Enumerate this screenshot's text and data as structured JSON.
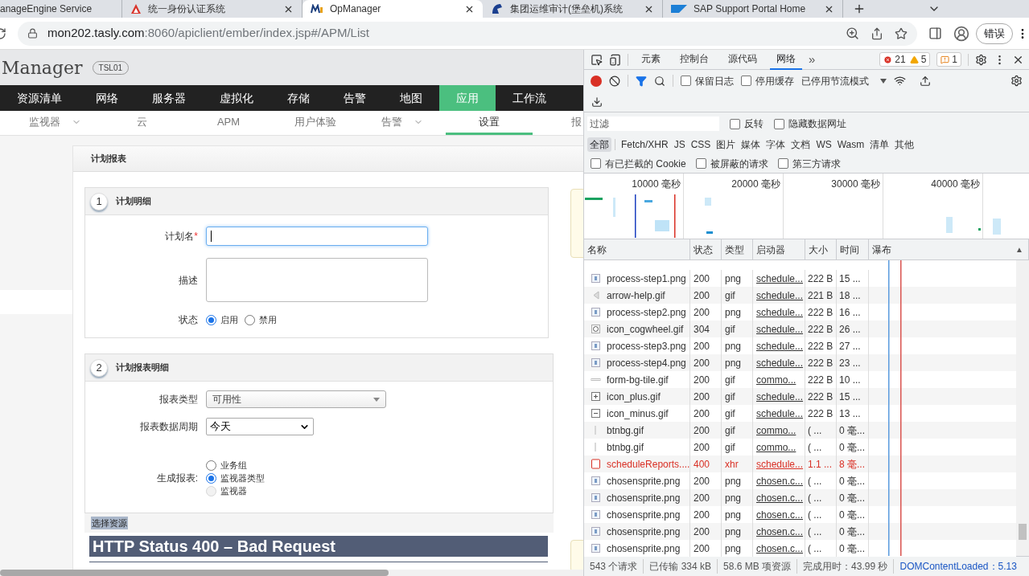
{
  "browser": {
    "tabs": [
      {
        "title": "anageEngine Service",
        "selected": false,
        "closable": false
      },
      {
        "title": "统一身份认证系统",
        "selected": false,
        "closable": true
      },
      {
        "title": "OpManager",
        "selected": true,
        "closable": true
      },
      {
        "title": "集团运维审计(堡垒机)系统",
        "selected": false,
        "closable": true
      },
      {
        "title": "SAP Support Portal Home",
        "selected": false,
        "closable": true
      }
    ],
    "url_host": "mon202.tasly.com",
    "url_path": ":8060/apiclient/ember/index.jsp#/APM/List",
    "profile_button": "错误"
  },
  "app": {
    "title": "Manager",
    "badge": "TSL01",
    "nav": [
      {
        "label": "资源清单",
        "selected": false
      },
      {
        "label": "网络",
        "selected": false
      },
      {
        "label": "服务器",
        "selected": false
      },
      {
        "label": "虚拟化",
        "selected": false
      },
      {
        "label": "存储",
        "selected": false
      },
      {
        "label": "告警",
        "selected": false
      },
      {
        "label": "地图",
        "selected": false
      },
      {
        "label": "应用",
        "selected": true
      },
      {
        "label": "工作流",
        "selected": false
      }
    ],
    "subnav": [
      {
        "label": "监视器",
        "selected": false,
        "dropdown": true
      },
      {
        "label": "云",
        "selected": false,
        "dropdown": false
      },
      {
        "label": "APM",
        "selected": false,
        "dropdown": false
      },
      {
        "label": "用户体验",
        "selected": false,
        "dropdown": false
      },
      {
        "label": "告警",
        "selected": false,
        "dropdown": true
      },
      {
        "label": "设置",
        "selected": true,
        "dropdown": false
      },
      {
        "label": "报",
        "selected": false,
        "dropdown": false
      }
    ],
    "card_title": "计划报表",
    "sections": [
      {
        "number": "1",
        "title": "计划明细",
        "fields": [
          {
            "kind": "text",
            "label": "计划名",
            "required_mark": "*",
            "focused": true
          },
          {
            "kind": "textarea",
            "label": "描述"
          },
          {
            "kind": "radio_row",
            "label": "状态",
            "options": [
              {
                "label": "启用",
                "selected": true,
                "disabled": false
              },
              {
                "label": "禁用",
                "selected": false,
                "disabled": false
              }
            ]
          }
        ]
      },
      {
        "number": "2",
        "title": "计划报表明细",
        "fields": [
          {
            "kind": "chosen_select",
            "label": "报表类型",
            "value": "可用性"
          },
          {
            "kind": "native_select",
            "label": "报表数据周期",
            "value": "今天"
          },
          {
            "kind": "radio_stack",
            "label": "生成报表:",
            "options": [
              {
                "label": "业务组",
                "selected": false,
                "disabled": false
              },
              {
                "label": "监视器类型",
                "selected": true,
                "disabled": false
              },
              {
                "label": "监视器",
                "selected": false,
                "disabled": true
              }
            ]
          }
        ]
      }
    ],
    "selected_text": "选择资源",
    "error_heading": "HTTP Status 400 – Bad Request"
  },
  "devtools": {
    "tabs": [
      {
        "label": "元素",
        "selected": false
      },
      {
        "label": "控制台",
        "selected": false
      },
      {
        "label": "源代码",
        "selected": false
      },
      {
        "label": "网络",
        "selected": true
      }
    ],
    "more_tabs": "»",
    "errors": "21",
    "warnings": "5",
    "issues": "1",
    "recording": true,
    "toolbar_checkboxes": [
      {
        "label": "保留日志",
        "checked": false
      },
      {
        "label": "停用缓存",
        "checked": false
      }
    ],
    "throttle": "已停用节流模式",
    "filter_placeholder": "过滤",
    "filter_checkboxes": [
      {
        "label": "反转",
        "checked": false
      },
      {
        "label": "隐藏数据网址",
        "checked": false
      }
    ],
    "type_filters": [
      {
        "label": "全部",
        "selected": true
      },
      {
        "label": "Fetch/XHR",
        "selected": false
      },
      {
        "label": "JS",
        "selected": false
      },
      {
        "label": "CSS",
        "selected": false
      },
      {
        "label": "图片",
        "selected": false
      },
      {
        "label": "媒体",
        "selected": false
      },
      {
        "label": "字体",
        "selected": false
      },
      {
        "label": "文档",
        "selected": false
      },
      {
        "label": "WS",
        "selected": false
      },
      {
        "label": "Wasm",
        "selected": false
      },
      {
        "label": "清单",
        "selected": false
      },
      {
        "label": "其他",
        "selected": false
      }
    ],
    "extra_checkboxes": [
      {
        "label": "有已拦截的 Cookie",
        "checked": false
      },
      {
        "label": "被屏蔽的请求",
        "checked": false
      },
      {
        "label": "第三方请求",
        "checked": false
      }
    ],
    "overview_ticks": [
      "10000 毫秒",
      "20000 毫秒",
      "30000 毫秒",
      "40000 毫秒"
    ],
    "columns": [
      "名称",
      "状态",
      "类型",
      "启动器",
      "大小",
      "时间",
      "瀑布"
    ],
    "sort_mark": "▲",
    "rows": [
      {
        "name": "process-step1.png",
        "status": "200",
        "type": "png",
        "initiator": "schedule...",
        "size": "222 B",
        "time": "15 ...",
        "kind": "image",
        "error": false
      },
      {
        "name": "arrow-help.gif",
        "status": "200",
        "type": "gif",
        "initiator": "schedule...",
        "size": "221 B",
        "time": "18 ...",
        "kind": "arrow",
        "error": false
      },
      {
        "name": "process-step2.png",
        "status": "200",
        "type": "png",
        "initiator": "schedule...",
        "size": "222 B",
        "time": "16 ...",
        "kind": "image",
        "error": false
      },
      {
        "name": "icon_cogwheel.gif",
        "status": "304",
        "type": "gif",
        "initiator": "schedule...",
        "size": "222 B",
        "time": "26 ...",
        "kind": "cog",
        "error": false
      },
      {
        "name": "process-step3.png",
        "status": "200",
        "type": "png",
        "initiator": "schedule...",
        "size": "222 B",
        "time": "27 ...",
        "kind": "image",
        "error": false
      },
      {
        "name": "process-step4.png",
        "status": "200",
        "type": "png",
        "initiator": "schedule...",
        "size": "222 B",
        "time": "23 ...",
        "kind": "image",
        "error": false
      },
      {
        "name": "form-bg-tile.gif",
        "status": "200",
        "type": "gif",
        "initiator": "commo...",
        "size": "222 B",
        "time": "10 ...",
        "kind": "line",
        "error": false
      },
      {
        "name": "icon_plus.gif",
        "status": "200",
        "type": "gif",
        "initiator": "schedule...",
        "size": "222 B",
        "time": "15 ...",
        "kind": "plus",
        "error": false
      },
      {
        "name": "icon_minus.gif",
        "status": "200",
        "type": "gif",
        "initiator": "schedule...",
        "size": "222 B",
        "time": "13 ...",
        "kind": "minus",
        "error": false
      },
      {
        "name": "btnbg.gif",
        "status": "200",
        "type": "gif",
        "initiator": "commo...",
        "size": "( ...",
        "time": "0 毫...",
        "kind": "bar",
        "error": false
      },
      {
        "name": "btnbg.gif",
        "status": "200",
        "type": "gif",
        "initiator": "commo...",
        "size": "( ...",
        "time": "0 毫...",
        "kind": "bar",
        "error": false
      },
      {
        "name": "scheduleReports....",
        "status": "400",
        "type": "xhr",
        "initiator": "schedule...",
        "size": "1.1 ...",
        "time": "8 毫...",
        "kind": "doc",
        "error": true
      },
      {
        "name": "chosensprite.png",
        "status": "200",
        "type": "png",
        "initiator": "chosen.c...",
        "size": "( ...",
        "time": "0 毫...",
        "kind": "image",
        "error": false
      },
      {
        "name": "chosensprite.png",
        "status": "200",
        "type": "png",
        "initiator": "chosen.c...",
        "size": "( ...",
        "time": "0 毫...",
        "kind": "image",
        "error": false
      },
      {
        "name": "chosensprite.png",
        "status": "200",
        "type": "png",
        "initiator": "chosen.c...",
        "size": "( ...",
        "time": "0 毫...",
        "kind": "image",
        "error": false
      },
      {
        "name": "chosensprite.png",
        "status": "200",
        "type": "png",
        "initiator": "chosen.c...",
        "size": "( ...",
        "time": "0 毫...",
        "kind": "image",
        "error": false
      },
      {
        "name": "chosensprite.png",
        "status": "200",
        "type": "png",
        "initiator": "chosen.c...",
        "size": "( ...",
        "time": "0 毫...",
        "kind": "image",
        "error": false
      }
    ],
    "status_bar": [
      {
        "text": "543 个请求",
        "kind": "plain"
      },
      {
        "text": "已传输 334 kB",
        "kind": "plain"
      },
      {
        "text": "58.6 MB 项资源",
        "kind": "plain"
      },
      {
        "text": "完成用时：43.99 秒",
        "kind": "plain"
      },
      {
        "text": "DOMContentLoaded：5.13",
        "kind": "link"
      }
    ]
  }
}
